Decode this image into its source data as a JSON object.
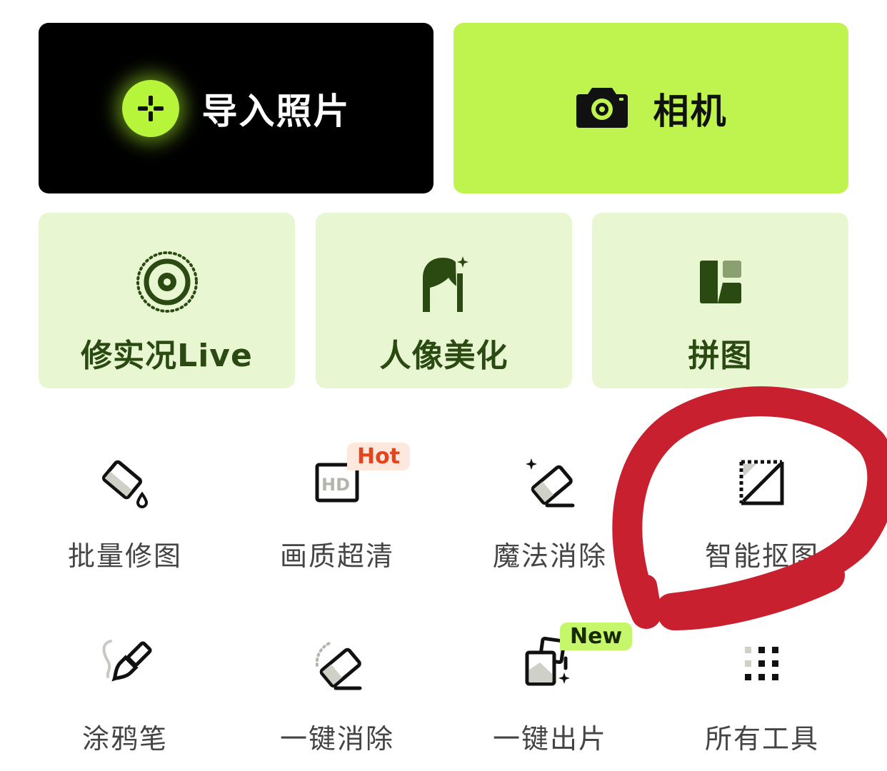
{
  "primary_actions": {
    "import_label": "导入照片",
    "camera_label": "相机"
  },
  "feature_cards": [
    {
      "label": "修实况Live",
      "icon": "live-photo-icon"
    },
    {
      "label": "人像美化",
      "icon": "portrait-icon"
    },
    {
      "label": "拼图",
      "icon": "collage-icon"
    }
  ],
  "tools": [
    {
      "label": "批量修图",
      "icon": "batch-edit-icon"
    },
    {
      "label": "画质超清",
      "icon": "hd-icon",
      "badge": "Hot"
    },
    {
      "label": "魔法消除",
      "icon": "magic-eraser-icon"
    },
    {
      "label": "智能抠图",
      "icon": "smart-cutout-icon"
    },
    {
      "label": "涂鸦笔",
      "icon": "brush-icon"
    },
    {
      "label": "一键消除",
      "icon": "eraser-icon"
    },
    {
      "label": "一键出片",
      "icon": "one-click-photo-icon",
      "badge": "New"
    },
    {
      "label": "所有工具",
      "icon": "all-tools-grid-icon"
    }
  ],
  "colors": {
    "accent_green": "#bef44d",
    "card_bg": "#e8f7d1",
    "hot_badge": "#e8431a",
    "annotation_red": "#c8202e"
  }
}
